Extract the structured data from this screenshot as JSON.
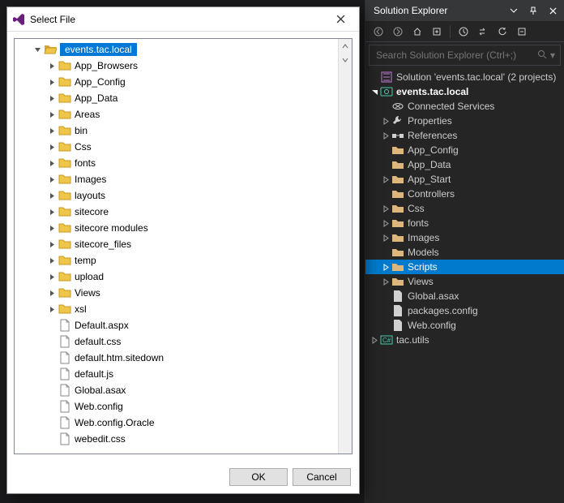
{
  "dialog": {
    "title": "Select File",
    "ok": "OK",
    "cancel": "Cancel",
    "root": "events.tac.local",
    "folders": [
      "App_Browsers",
      "App_Config",
      "App_Data",
      "Areas",
      "bin",
      "Css",
      "fonts",
      "Images",
      "layouts",
      "sitecore",
      "sitecore modules",
      "sitecore_files",
      "temp",
      "upload",
      "Views",
      "xsl"
    ],
    "files": [
      "Default.aspx",
      "default.css",
      "default.htm.sitedown",
      "default.js",
      "Global.asax",
      "Web.config",
      "Web.config.Oracle",
      "webedit.css"
    ]
  },
  "panel": {
    "title": "Solution Explorer",
    "search_placeholder": "Search Solution Explorer (Ctrl+;)",
    "solution": "Solution 'events.tac.local' (2 projects)",
    "project": "events.tac.local",
    "connected": "Connected Services",
    "properties": "Properties",
    "references": "References",
    "folders": [
      "App_Config",
      "App_Data",
      "App_Start",
      "Controllers",
      "Css",
      "fonts",
      "Images",
      "Models",
      "Scripts",
      "Views"
    ],
    "expandable_folders": [
      "App_Start",
      "Css",
      "fonts",
      "Images",
      "Scripts",
      "Views"
    ],
    "selected_folder": "Scripts",
    "files": [
      "Global.asax",
      "packages.config",
      "Web.config"
    ],
    "project2": "tac.utils"
  }
}
